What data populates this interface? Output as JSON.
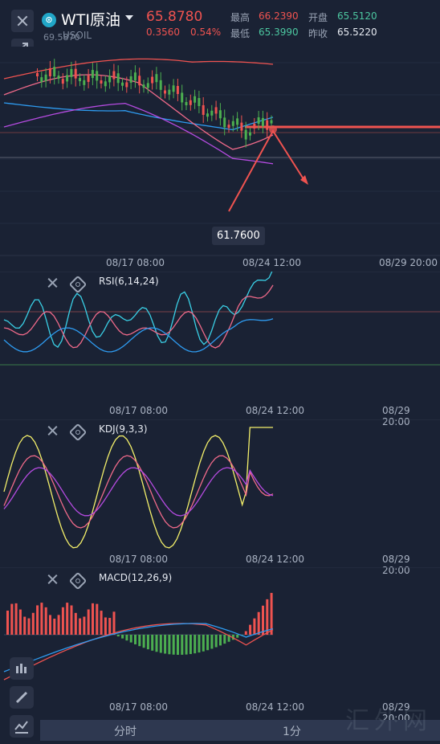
{
  "header": {
    "symbol": "WTI原油",
    "symbol_code": "USOIL",
    "prev_label": "69.5870",
    "price": "65.8780",
    "change": "0.3560",
    "change_pct": "0.54%",
    "high_label": "最高",
    "high": "66.2390",
    "open_label": "开盘",
    "open": "65.5120",
    "low_label": "最低",
    "low": "65.3990",
    "prev_close_label": "昨收",
    "prev_close": "65.5220"
  },
  "main_chart": {
    "low_marker": "61.7600",
    "x_ticks": [
      "08/17 08:00",
      "08/24 12:00",
      "08/29 20:00"
    ]
  },
  "rsi": {
    "title": "RSI(6,14,24)",
    "x_ticks": [
      "08/17 08:00",
      "08/24 12:00",
      "08/29 20:00"
    ]
  },
  "kdj": {
    "title": "KDJ(9,3,3)",
    "x_ticks": [
      "08/17 08:00",
      "08/24 12:00",
      "08/29 20:00"
    ]
  },
  "macd": {
    "title": "MACD(12,26,9)",
    "x_ticks": [
      "08/17 08:00",
      "08/24 12:00",
      "08/29 20:00"
    ]
  },
  "bottom_tabs": [
    "分时",
    "1分"
  ],
  "watermark": "汇外网",
  "colors": {
    "background": "#1a2234",
    "up": "#ef5350",
    "down": "#4caf50",
    "line_red": "#ef5350",
    "line_blue": "#2e9bf0",
    "line_purple": "#b54be0",
    "line_yellow": "#f3ef6a",
    "line_cyan": "#3ad0e6",
    "line_pink": "#f06a8a"
  }
}
